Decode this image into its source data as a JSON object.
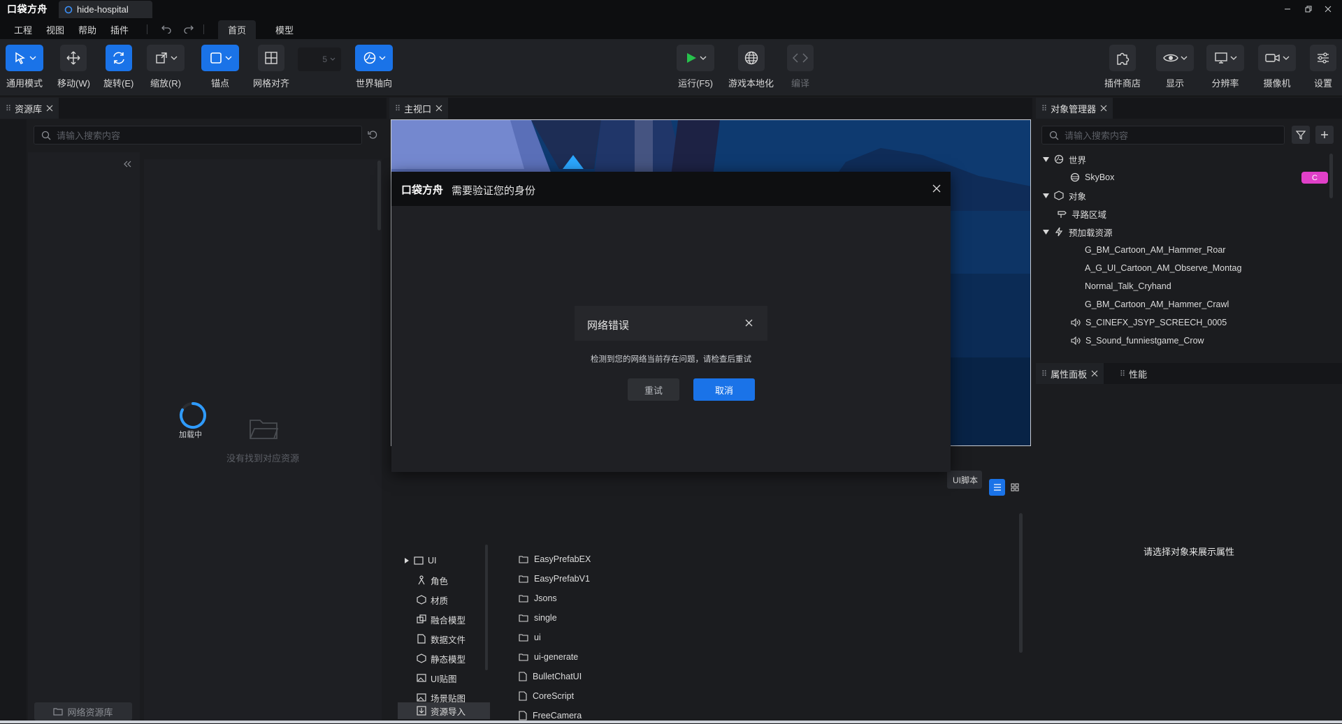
{
  "app": {
    "logo_text": "口袋方舟",
    "doc_tab": "hide-hospital"
  },
  "menu": {
    "items": [
      "工程",
      "视图",
      "帮助",
      "插件"
    ],
    "mode_tabs": [
      "首页",
      "模型"
    ]
  },
  "toolbar": {
    "general_mode": "通用模式",
    "move": "移动(W)",
    "rotate": "旋转(E)",
    "scale": "缩放(R)",
    "anchor": "锚点",
    "grid_snap": "网格对齐",
    "grid_value": "5",
    "world_axis": "世界轴向",
    "run": "运行(F5)",
    "localize": "游戏本地化",
    "compile": "编译",
    "plugin_store": "插件商店",
    "display": "显示",
    "resolution": "分辨率",
    "camera": "摄像机",
    "settings": "设置"
  },
  "asset_panel": {
    "tab": "资源库",
    "search_placeholder": "请输入搜索内容",
    "loading": "加载中",
    "empty": "没有找到对应资源",
    "network_assets": "网络资源库"
  },
  "viewport": {
    "tab": "主视口"
  },
  "project_panel": {
    "ui_script_btn": "UI脚本",
    "categories": [
      "UI",
      "角色",
      "材质",
      "融合模型",
      "数据文件",
      "静态模型",
      "UI贴图",
      "场景贴图",
      "资源导入"
    ],
    "folders": [
      "EasyPrefabEX",
      "EasyPrefabV1",
      "Jsons",
      "single",
      "ui",
      "ui-generate"
    ],
    "files": [
      "BulletChatUI",
      "CoreScript",
      "FreeCamera"
    ]
  },
  "object_manager": {
    "tab": "对象管理器",
    "search_placeholder": "请输入搜索内容",
    "world": "世界",
    "skybox": "SkyBox",
    "skybox_badge": "C",
    "objects": "对象",
    "pathfinding": "寻路区域",
    "preload": "预加载资源",
    "preload_items": [
      "G_BM_Cartoon_AM_Hammer_Roar",
      "A_G_UI_Cartoon_AM_Observe_Montag",
      "Normal_Talk_Cryhand",
      "G_BM_Cartoon_AM_Hammer_Crawl"
    ],
    "sound_items": [
      "S_CINEFX_JSYP_SCREECH_0005",
      "S_Sound_funniestgame_Crow"
    ]
  },
  "property_panel": {
    "tab": "属性面板",
    "perf_tab": "性能",
    "empty": "请选择对象来展示属性"
  },
  "auth_dialog": {
    "title": "需要验证您的身份"
  },
  "network_dialog": {
    "title": "网络错误",
    "message": "检测到您的网络当前存在问题，请检查后重试",
    "retry": "重试",
    "cancel": "取消"
  },
  "colors": {
    "accent": "#1a73e8",
    "badge": "#e040c8",
    "run_green": "#27c24c"
  }
}
